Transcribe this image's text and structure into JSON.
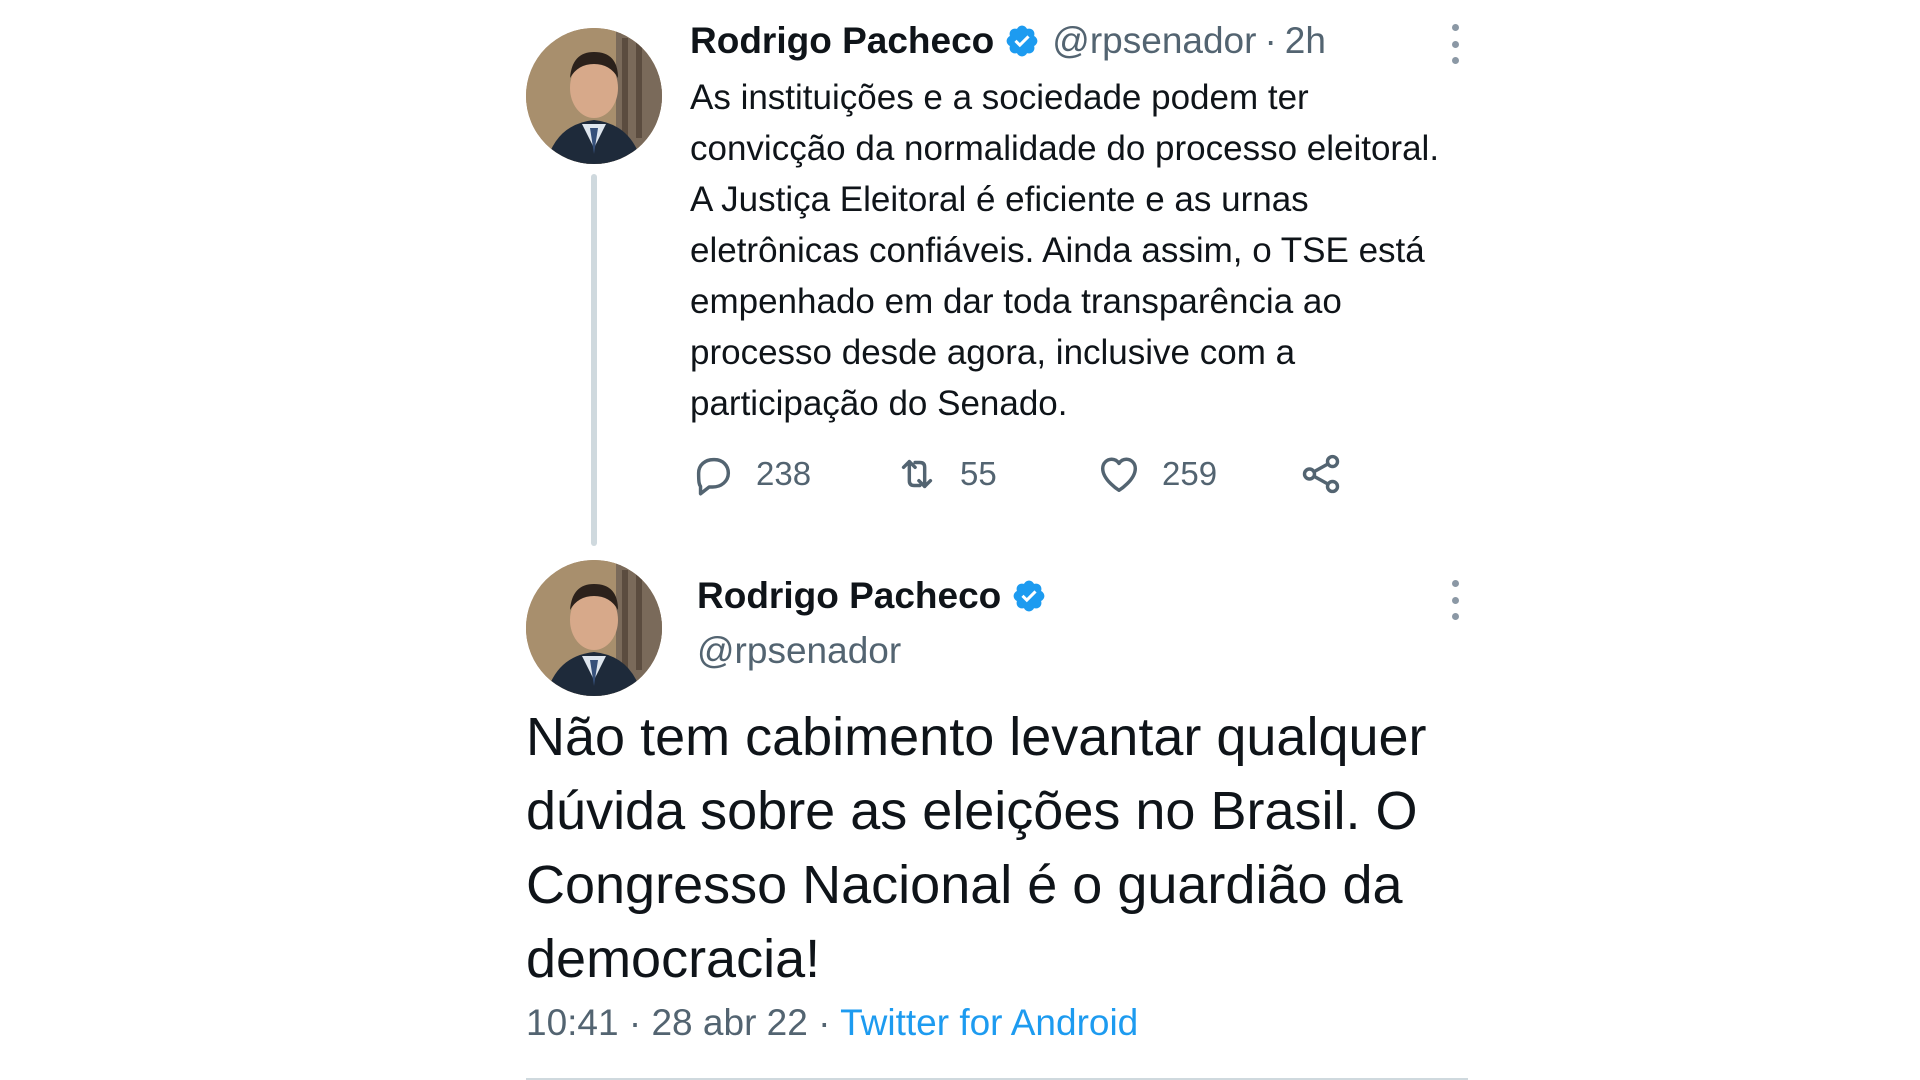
{
  "tweet1": {
    "name": "Rodrigo Pacheco",
    "handle": "@rpsenador",
    "separator": "·",
    "time": "2h",
    "text": "As instituições e a sociedade podem ter convicção da normalidade do processo eleitoral. A Justiça Eleitoral é eficiente e as urnas eletrônicas confiáveis. Ainda assim, o TSE está empenhado em dar toda transparência ao processo desde agora, inclusive com a participação do Senado.",
    "replies": "238",
    "retweets": "55",
    "likes": "259"
  },
  "tweet2": {
    "name": "Rodrigo Pacheco",
    "handle": "@rpsenador",
    "text": "Não tem cabimento levantar qualquer dúvida sobre as eleições no Brasil. O Congresso Nacional é o guardião da democracia!",
    "time": "10:41",
    "separator": "·",
    "date": "28 abr 22",
    "source": "Twitter for Android"
  },
  "icons": {
    "verified": "verified-badge-icon",
    "reply": "reply-icon",
    "retweet": "retweet-icon",
    "like": "heart-icon",
    "share": "share-icon",
    "more": "more-vertical-icon"
  },
  "colors": {
    "verified": "#1d9bf0",
    "link": "#1d9bf0",
    "secondary_text": "#536471",
    "thread_line": "#cfd9de"
  }
}
